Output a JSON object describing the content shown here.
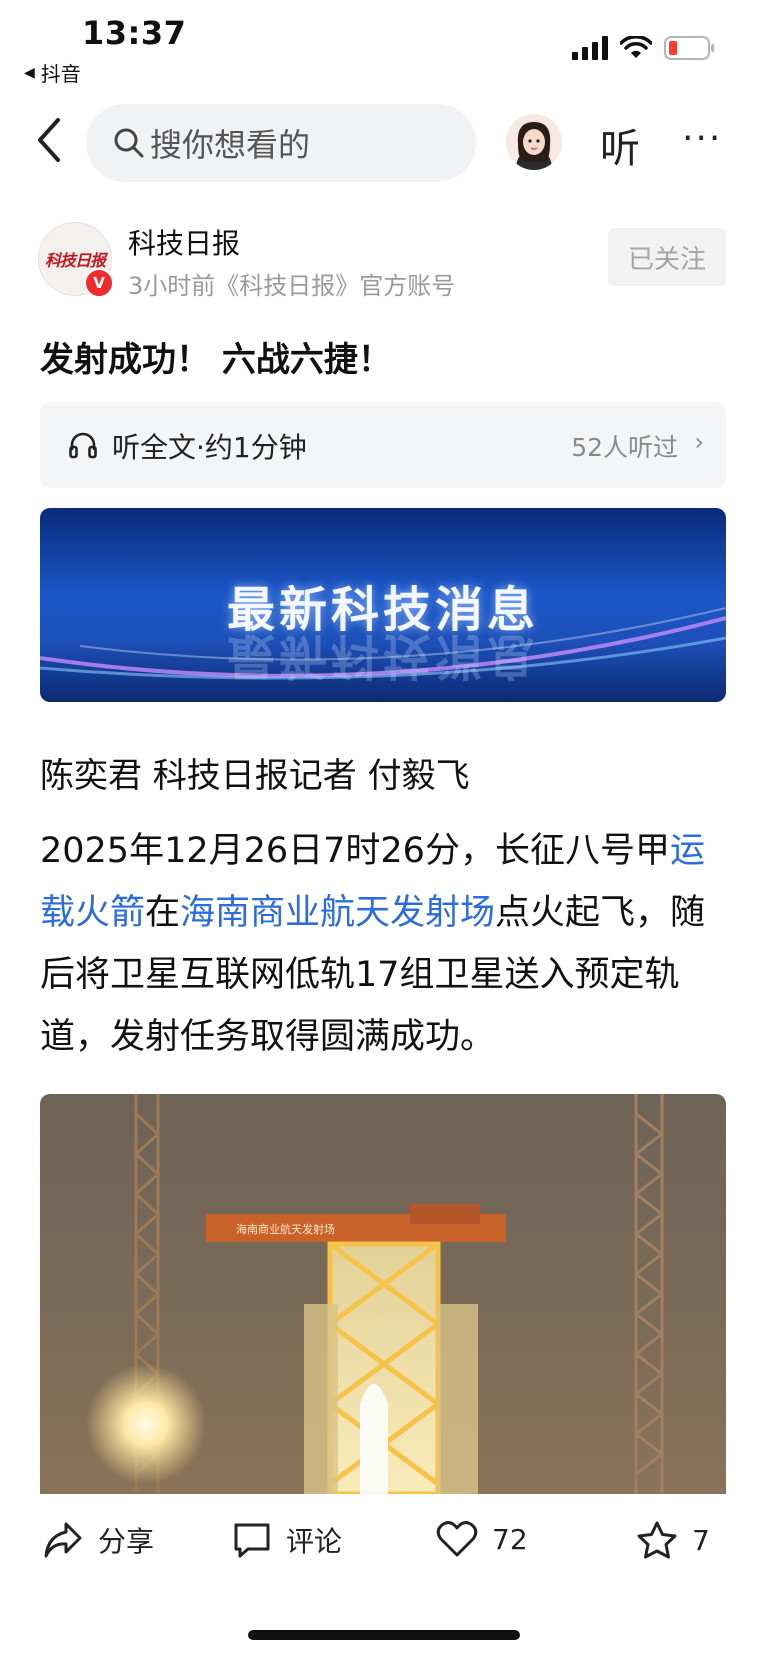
{
  "status_bar": {
    "time": "13:37",
    "back_app": "抖音"
  },
  "header": {
    "search_placeholder": "搜你想看的",
    "listen_label": "听",
    "more_label": "···"
  },
  "author": {
    "logo_text": "科技日报",
    "verified_mark": "V",
    "name": "科技日报",
    "meta": "3小时前《科技日报》官方账号",
    "follow_label": "已关注"
  },
  "article": {
    "title": "发射成功！ 六战六捷！",
    "listen_bar": {
      "label": "听全文·约1分钟",
      "count": "52人听过"
    },
    "banner_text": "最新科技消息",
    "byline": "陈奕君 科技日报记者 付毅飞",
    "paragraph": {
      "part1": "2025年12月26日7时26分，长征八号甲",
      "link1": "运载火箭",
      "part2": "在",
      "link2": "海南商业航天发射场",
      "part3": "点火起飞，随后将卫星互联网低轨17组卫星送入预定轨道，发射任务取得圆满成功。"
    },
    "photo_caption": "海南商业航天发射场"
  },
  "bottom_bar": {
    "share": "分享",
    "comment": "评论",
    "likes": "72",
    "favorites": "7"
  },
  "colors": {
    "link": "#2d6cdf",
    "verify_badge": "#ef2b2b",
    "battery_low": "#ff3b30"
  }
}
